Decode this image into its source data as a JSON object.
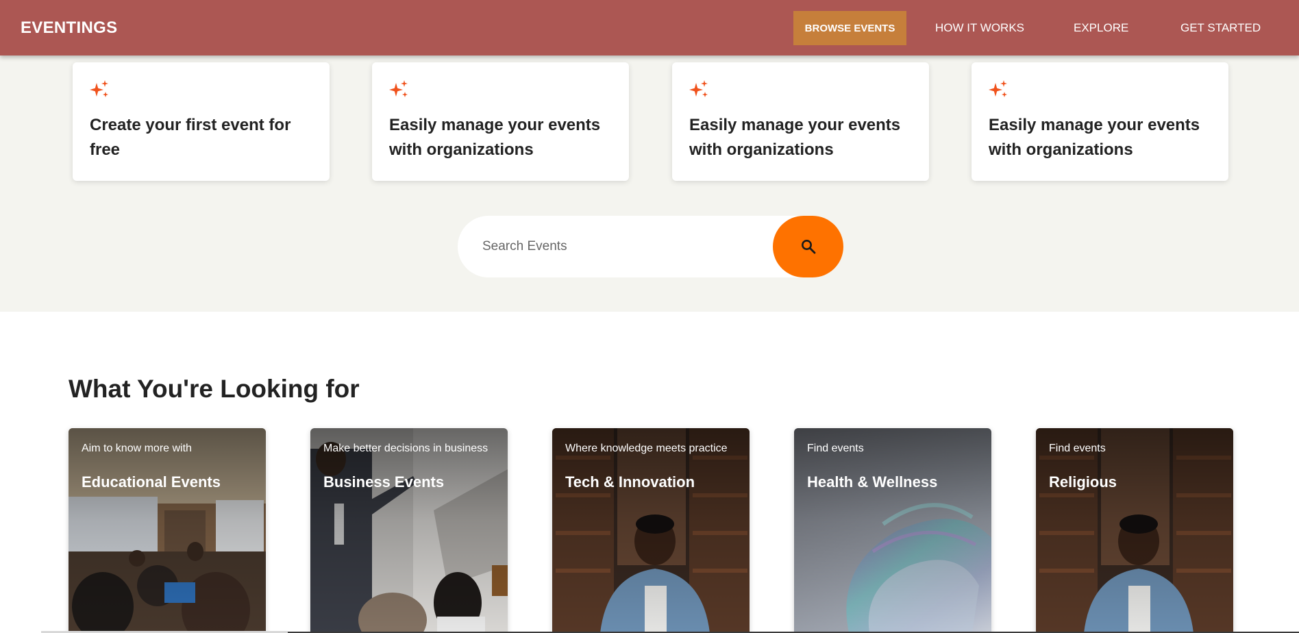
{
  "header": {
    "brand": "EVENTINGS",
    "nav": {
      "browse": "BROWSE EVENTS",
      "how": "HOW IT WORKS",
      "explore": "EXPLORE",
      "start": "GET STARTED"
    }
  },
  "features": [
    {
      "icon": "sparkle-icon",
      "text": "Create your first event for free"
    },
    {
      "icon": "sparkle-icon",
      "text": "Easily manage your events with organizations"
    },
    {
      "icon": "sparkle-icon",
      "text": "Easily manage your events with organizations"
    },
    {
      "icon": "sparkle-icon",
      "text": "Easily manage your events with organizations"
    }
  ],
  "search": {
    "placeholder": "Search Events",
    "button_icon": "search-icon"
  },
  "section": {
    "title": "What You're Looking for"
  },
  "categories": [
    {
      "subtitle": "Aim to know more with",
      "title": "Educational Events"
    },
    {
      "subtitle": "Make better decisions in business",
      "title": "Business Events"
    },
    {
      "subtitle": "Where knowledge meets practice",
      "title": "Tech & Innovation"
    },
    {
      "subtitle": "Find events",
      "title": "Health & Wellness"
    },
    {
      "subtitle": "Find events",
      "title": "Religious"
    }
  ],
  "colors": {
    "header_bg": "#ac5753",
    "browse_btn": "#c67f3b",
    "accent_orange": "#fe7200",
    "hero_bg": "#f4f4ef"
  }
}
